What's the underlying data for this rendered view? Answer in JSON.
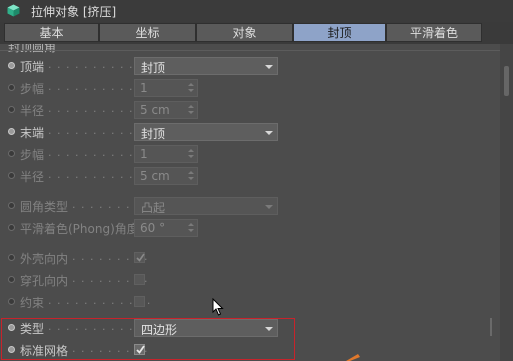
{
  "window": {
    "title": "拉伸对象 [挤压]",
    "icon": "cube-object-icon",
    "accent_color": "#8ea3c8",
    "highlight_color": "#c8232b"
  },
  "tabs": [
    "基本",
    "坐标",
    "对象",
    "封顶",
    "平滑着色(Phong)"
  ],
  "active_tab": "封顶",
  "section": {
    "title": "封顶圆角"
  },
  "fields": {
    "top": {
      "label": "顶端",
      "value": "封顶"
    },
    "top_step": {
      "label": "步幅",
      "value": "1"
    },
    "top_radius": {
      "label": "半径",
      "value": "5 cm"
    },
    "end": {
      "label": "末端",
      "value": "封顶"
    },
    "end_step": {
      "label": "步幅",
      "value": "1"
    },
    "end_radius": {
      "label": "半径",
      "value": "5 cm"
    },
    "fillet_type": {
      "label": "圆角类型",
      "value": "凸起"
    },
    "phong_angle": {
      "label": "平滑着色(Phong)角度",
      "value": "60 °"
    },
    "shell_in": {
      "label": "外壳向内",
      "checked": true
    },
    "hole_in": {
      "label": "穿孔向内",
      "checked": false
    },
    "constrain": {
      "label": "约束",
      "checked": false
    },
    "type": {
      "label": "类型",
      "value": "四边形"
    },
    "std_mesh": {
      "label": "标准网格",
      "checked": true
    }
  }
}
